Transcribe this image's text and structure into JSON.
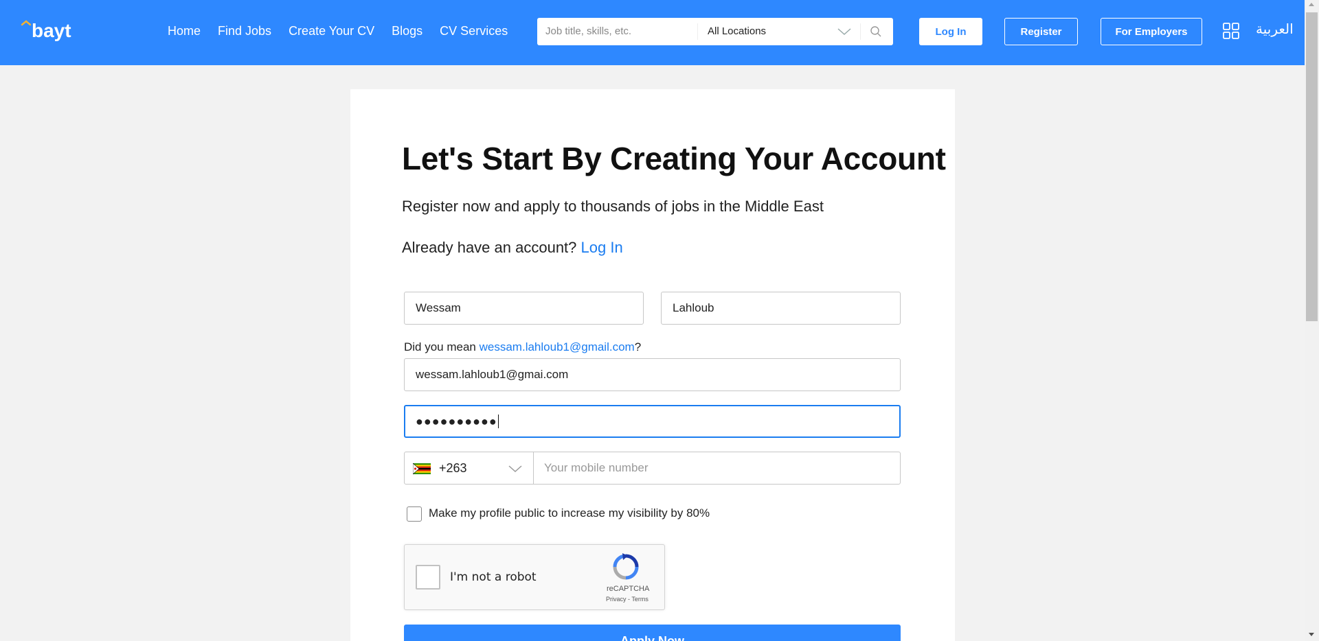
{
  "header": {
    "logo_text": "bayt",
    "nav": [
      "Home",
      "Find Jobs",
      "Create Your CV",
      "Blogs",
      "CV Services"
    ],
    "search_placeholder": "Job title, skills, etc.",
    "location_selected": "All Locations",
    "login_label": "Log In",
    "register_label": "Register",
    "employers_label": "For Employers",
    "language_label": "العربية"
  },
  "form": {
    "title": "Let's Start By Creating Your Account",
    "subtitle": "Register now and apply to thousands of jobs in the Middle East",
    "have_account_text": "Already have an account?",
    "login_link": "Log In",
    "first_name": "Wessam",
    "last_name": "Lahloub",
    "did_you_mean_prefix": "Did you mean",
    "did_you_mean_email": "wessam.lahloub1@gmail.com",
    "did_you_mean_suffix": "?",
    "email": "wessam.lahloub1@gmai.com",
    "password_masked": "●●●●●●●●●●",
    "phone_code": "+263",
    "mobile_placeholder": "Your mobile number",
    "public_profile_label": "Make my profile public to increase my visibility by 80%",
    "public_profile_checked": false,
    "captcha_label": "I'm not a robot",
    "captcha_brand": "reCAPTCHA",
    "captcha_terms": "Privacy - Terms",
    "apply_label": "Apply Now"
  },
  "colors": {
    "brand_blue": "#2e88ff",
    "link_blue": "#1a7cf0",
    "logo_accent": "#f2b233"
  },
  "icons": [
    "search-icon",
    "chevron-down-icon",
    "apps-grid-icon",
    "zimbabwe-flag-icon",
    "recaptcha-icon"
  ]
}
